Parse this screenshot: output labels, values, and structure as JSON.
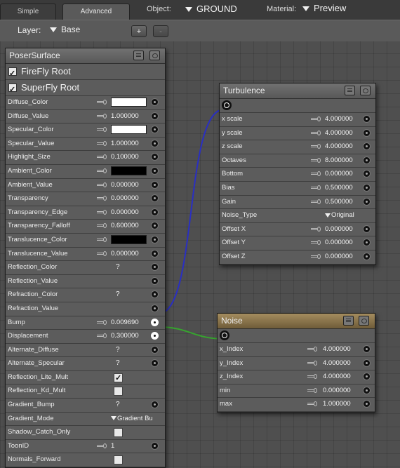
{
  "tabs": [
    {
      "label": "Simple"
    },
    {
      "label": "Advanced"
    }
  ],
  "toolbar": {
    "object_label": "Object:",
    "object_value": "GROUND",
    "material_label": "Material:",
    "material_value": "Preview"
  },
  "layer": {
    "label": "Layer:",
    "value": "Base",
    "add": "+",
    "remove": "-"
  },
  "poser": {
    "title": "PoserSurface",
    "checks": [
      {
        "label": "FireFly Root",
        "checked": true
      },
      {
        "label": "SuperFly Root",
        "checked": true
      }
    ],
    "rows": [
      {
        "label": "Diffuse_Color",
        "kind": "color",
        "color": "#ffffff",
        "port": true
      },
      {
        "label": "Diffuse_Value",
        "kind": "num",
        "value": "1.000000",
        "port": true
      },
      {
        "label": "Specular_Color",
        "kind": "color",
        "color": "#ffffff",
        "port": true
      },
      {
        "label": "Specular_Value",
        "kind": "num",
        "value": "1.000000",
        "port": true
      },
      {
        "label": "Highlight_Size",
        "kind": "num",
        "value": "0.100000",
        "port": true
      },
      {
        "label": "Ambient_Color",
        "kind": "color",
        "color": "#000000",
        "port": true
      },
      {
        "label": "Ambient_Value",
        "kind": "num",
        "value": "0.000000",
        "port": true
      },
      {
        "label": "Transparency",
        "kind": "num",
        "value": "0.000000",
        "port": true
      },
      {
        "label": "Transparency_Edge",
        "kind": "num",
        "value": "0.000000",
        "port": true
      },
      {
        "label": "Transparency_Falloff",
        "kind": "num",
        "value": "0.600000",
        "port": true
      },
      {
        "label": "Translucence_Color",
        "kind": "color",
        "color": "#000000",
        "port": true
      },
      {
        "label": "Translucence_Value",
        "kind": "num",
        "value": "0.000000",
        "port": true
      },
      {
        "label": "Reflection_Color",
        "kind": "q",
        "value": "?",
        "port": true
      },
      {
        "label": "Reflection_Value",
        "kind": "none",
        "port": true
      },
      {
        "label": "Refraction_Color",
        "kind": "q",
        "value": "?",
        "port": true
      },
      {
        "label": "Refraction_Value",
        "kind": "none",
        "port": true
      },
      {
        "label": "Bump",
        "kind": "num",
        "value": "0.009690",
        "port": true,
        "linked": true
      },
      {
        "label": "Displacement",
        "kind": "num",
        "value": "0.300000",
        "port": true,
        "linked": true
      },
      {
        "label": "Alternate_Diffuse",
        "kind": "q",
        "value": "?",
        "port": true
      },
      {
        "label": "Alternate_Specular",
        "kind": "q",
        "value": "?",
        "port": true
      },
      {
        "label": "Reflection_Lite_Mult",
        "kind": "check",
        "checked": true,
        "port": false
      },
      {
        "label": "Reflection_Kd_Mult",
        "kind": "check",
        "checked": false,
        "port": false
      },
      {
        "label": "Gradient_Bump",
        "kind": "q",
        "value": "?",
        "port": true
      },
      {
        "label": "Gradient_Mode",
        "kind": "dropdown",
        "value": "Gradient Bu",
        "port": false
      },
      {
        "label": "Shadow_Catch_Only",
        "kind": "check",
        "checked": false,
        "port": false
      },
      {
        "label": "ToonID",
        "kind": "int",
        "value": "1",
        "port": true
      },
      {
        "label": "Normals_Forward",
        "kind": "check",
        "checked": false,
        "port": false
      }
    ]
  },
  "turbulence": {
    "title": "Turbulence",
    "rows": [
      {
        "label": "x scale",
        "kind": "num",
        "value": "4.000000",
        "port": true
      },
      {
        "label": "y scale",
        "kind": "num",
        "value": "4.000000",
        "port": true
      },
      {
        "label": "z scale",
        "kind": "num",
        "value": "4.000000",
        "port": true
      },
      {
        "label": "Octaves",
        "kind": "num",
        "value": "8.000000",
        "port": true
      },
      {
        "label": "Bottom",
        "kind": "num",
        "value": "0.000000",
        "port": true
      },
      {
        "label": "Bias",
        "kind": "num",
        "value": "0.500000",
        "port": true
      },
      {
        "label": "Gain",
        "kind": "num",
        "value": "0.500000",
        "port": true
      },
      {
        "label": "Noise_Type",
        "kind": "dropdown",
        "value": "Original",
        "port": false
      },
      {
        "label": "Offset X",
        "kind": "num",
        "value": "0.000000",
        "port": true
      },
      {
        "label": "Offset Y",
        "kind": "num",
        "value": "0.000000",
        "port": true
      },
      {
        "label": "Offset Z",
        "kind": "num",
        "value": "0.000000",
        "port": true
      }
    ]
  },
  "noise": {
    "title": "Noise",
    "rows": [
      {
        "label": "x_Index",
        "kind": "num",
        "value": "4.000000",
        "port": true
      },
      {
        "label": "y_Index",
        "kind": "num",
        "value": "4.000000",
        "port": true
      },
      {
        "label": "z_Index",
        "kind": "num",
        "value": "4.000000",
        "port": true
      },
      {
        "label": "min",
        "kind": "num",
        "value": "0.000000",
        "port": true
      },
      {
        "label": "max",
        "kind": "num",
        "value": "1.000000",
        "port": true
      }
    ]
  },
  "wires": {
    "bump_color": "#2a2fc2",
    "displacement_color": "#36a52e"
  }
}
